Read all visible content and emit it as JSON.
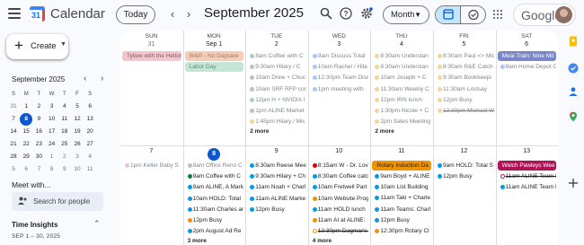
{
  "header": {
    "app_title": "Calendar",
    "logo_num": "31",
    "today_label": "Today",
    "prev_icon": "chevron-left-icon",
    "next_icon": "chevron-right-icon",
    "period": "September 2025",
    "view_label": "Month",
    "account_label": "Google"
  },
  "sidebar": {
    "create_label": "Create",
    "mini_title": "September 2025",
    "weekday_initials": [
      "S",
      "M",
      "T",
      "W",
      "T",
      "F",
      "S"
    ],
    "weeks": [
      [
        "31",
        "1",
        "2",
        "3",
        "4",
        "5",
        "6"
      ],
      [
        "7",
        "8",
        "9",
        "10",
        "11",
        "12",
        "13"
      ],
      [
        "14",
        "15",
        "16",
        "17",
        "18",
        "19",
        "20"
      ],
      [
        "21",
        "22",
        "23",
        "24",
        "25",
        "26",
        "27"
      ],
      [
        "28",
        "29",
        "30",
        "1",
        "2",
        "3",
        "4"
      ],
      [
        "5",
        "6",
        "7",
        "8",
        "9",
        "10",
        "11"
      ]
    ],
    "selected_day": "8",
    "meet_title": "Meet with...",
    "search_placeholder": "Search for people",
    "insights_title": "Time Insights",
    "insights_range": "SEP 1 – 30, 2025"
  },
  "grid": {
    "weekdays": [
      "SUN",
      "MON",
      "TUE",
      "WED",
      "THU",
      "FRI",
      "SAT"
    ],
    "week1_days": [
      "31",
      "Sep 1",
      "2",
      "3",
      "4",
      "5",
      "6"
    ],
    "week2_days": [
      "7",
      "8",
      "9",
      "10",
      "11",
      "12",
      "13"
    ],
    "week1_bars": [
      {
        "col": 0,
        "text": "Tybee with the Heltons!",
        "bg": "#f3c5ce",
        "fg": "#7f6066"
      },
      {
        "col": 1,
        "text": "W&P - No Daycare",
        "bg": "#f3cdb8",
        "fg": "#a0766a"
      },
      {
        "col": 1,
        "text": "Labor Day",
        "bg": "#c5e6d5",
        "fg": "#5d8f74"
      },
      {
        "col": 6,
        "text": "Meal Train: Nine Mil",
        "bg": "#7b86c6",
        "fg": "#ffffff"
      }
    ],
    "week1_events": [
      {
        "col": 2,
        "text": "8am Coffee with C",
        "dot": "#b6c7c0",
        "past": true
      },
      {
        "col": 2,
        "text": "9:30am Hilary / C",
        "dot": "#b6c7c0",
        "past": true
      },
      {
        "col": 2,
        "text": "10am Drew + Chuc",
        "dot": "#b6c7c0",
        "past": true
      },
      {
        "col": 2,
        "text": "10am SRF RFP con",
        "dot": "#b6c7c0",
        "past": true
      },
      {
        "col": 2,
        "text": "12pm H + NVIDIA I",
        "dot": "#b6c7c0",
        "past": true
      },
      {
        "col": 2,
        "text": "1pm ALINE Market",
        "dot": "#b6c7c0",
        "past": true
      },
      {
        "col": 2,
        "text": "1:45pm Hilary / Mic",
        "dot": "#f4d49b",
        "past": true
      },
      {
        "col": 3,
        "text": "9am Discuss Total",
        "dot": "#a8c7fa",
        "past": true
      },
      {
        "col": 3,
        "text": "10am Rachel / Hila",
        "dot": "#a8c7fa",
        "past": true
      },
      {
        "col": 3,
        "text": "12:30pm Team Disc",
        "dot": "#a8c7fa",
        "past": true
      },
      {
        "col": 3,
        "text": "1pm meeting with",
        "dot": "#a8c7fa",
        "past": true
      },
      {
        "col": 4,
        "text": "8:30am Understan",
        "dot": "#f4d49b",
        "past": true
      },
      {
        "col": 4,
        "text": "8:30am Understan",
        "dot": "#f4d49b",
        "past": true
      },
      {
        "col": 4,
        "text": "10am Joseph + C",
        "dot": "#f4d49b",
        "past": true
      },
      {
        "col": 4,
        "text": "11:30am Weekly C",
        "dot": "#f4d49b",
        "past": true
      },
      {
        "col": 4,
        "text": "12pm IRN lunch",
        "dot": "#f4d49b",
        "past": true
      },
      {
        "col": 4,
        "text": "1:30pm Nicole + C",
        "dot": "#f4d49b",
        "past": true
      },
      {
        "col": 4,
        "text": "2pm Sales Meeting",
        "dot": "#f4d49b",
        "past": true
      },
      {
        "col": 5,
        "text": "8:30am Paul <> Mic",
        "dot": "#f4d49b",
        "past": true
      },
      {
        "col": 5,
        "text": "8:30am R&E Catch",
        "dot": "#f4d49b",
        "past": true
      },
      {
        "col": 5,
        "text": "9:30am Bookkeepi",
        "dot": "#f4d49b",
        "past": true
      },
      {
        "col": 5,
        "text": "11:30am Lindsay",
        "dot": "#f4d49b",
        "past": true
      },
      {
        "col": 5,
        "text": "12pm Busy",
        "dot": "#f4d49b",
        "past": true
      },
      {
        "col": 5,
        "text": "12:30pm Michael W",
        "dot": "#f4d49b",
        "past": true,
        "strike": true
      },
      {
        "col": 6,
        "text": "9am Home Depot C",
        "dot": "#a8c7fa",
        "past": true
      }
    ],
    "week1_more": [
      {
        "col": 2,
        "text": "2 more"
      },
      {
        "col": 4,
        "text": "2 more"
      }
    ],
    "week2_bars": [
      {
        "col": 4,
        "text": "Rotary Induction Da",
        "bg": "#f09300",
        "fg": "#1f1f1f"
      },
      {
        "col": 6,
        "text": "Welch Pawleys Wee",
        "bg": "#ad1457",
        "fg": "#ffffff"
      }
    ],
    "week2_events": [
      {
        "col": 0,
        "text": "1pm Keller Baby S",
        "dot": "#f3c5ce",
        "past": true
      },
      {
        "col": 1,
        "text": "8am Office Reno C",
        "dot": "#b6c7c0",
        "past": true
      },
      {
        "col": 1,
        "text": "9am Coffee with C",
        "dot": "#0b8043"
      },
      {
        "col": 1,
        "text": "9am ALINE, A Mark",
        "dot": "#039be5"
      },
      {
        "col": 1,
        "text": "10am HOLD: Total",
        "dot": "#039be5"
      },
      {
        "col": 1,
        "text": "11:30am Charles an",
        "dot": "#039be5"
      },
      {
        "col": 1,
        "text": "12pm Busy",
        "dot": "#f09300"
      },
      {
        "col": 1,
        "text": "2pm August Ad Re",
        "dot": "#039be5"
      },
      {
        "col": 2,
        "text": "8:30am Reese Mee",
        "dot": "#039be5"
      },
      {
        "col": 2,
        "text": "9:30am Hilary + Ch",
        "dot": "#039be5"
      },
      {
        "col": 2,
        "text": "11am Noah + Charl",
        "dot": "#039be5"
      },
      {
        "col": 2,
        "text": "11am ALINE Marke",
        "dot": "#039be5"
      },
      {
        "col": 2,
        "text": "12pm Busy",
        "dot": "#039be5"
      },
      {
        "col": 3,
        "text": "8:15am W - Dr. Lov",
        "dot": "#d50000"
      },
      {
        "col": 3,
        "text": "8:30am Coffee catc",
        "dot": "#039be5"
      },
      {
        "col": 3,
        "text": "10am Fretwell Part",
        "dot": "#039be5"
      },
      {
        "col": 3,
        "text": "10am Website Prog",
        "dot": "#f09300"
      },
      {
        "col": 3,
        "text": "11am HOLD lunch",
        "dot": "#039be5"
      },
      {
        "col": 3,
        "text": "11am AI at ALINE:",
        "dot": "#f09300"
      },
      {
        "col": 3,
        "text": "12:30pm Dagmar's Bat",
        "dot": "#f09300",
        "ring": true,
        "strike": true
      },
      {
        "col": 4,
        "text": "9am Boyd + ALINE",
        "dot": "#039be5"
      },
      {
        "col": 4,
        "text": "10am List Building",
        "dot": "#039be5"
      },
      {
        "col": 4,
        "text": "11am Taki + Charle",
        "dot": "#039be5"
      },
      {
        "col": 4,
        "text": "11am Teams: Charl",
        "dot": "#039be5"
      },
      {
        "col": 4,
        "text": "12pm Busy",
        "dot": "#039be5"
      },
      {
        "col": 4,
        "text": "12:30pm Rotary Cl",
        "dot": "#f09300"
      },
      {
        "col": 5,
        "text": "9am HOLD: Total S",
        "dot": "#039be5"
      },
      {
        "col": 5,
        "text": "12pm Busy",
        "dot": "#039be5"
      },
      {
        "col": 6,
        "text": "11am ALINE Team F",
        "dot": "#ad1457",
        "ring": true,
        "strike": true
      },
      {
        "col": 6,
        "text": "11am ALINE Team F",
        "dot": "#039be5"
      }
    ],
    "week2_more": [
      {
        "col": 1,
        "text": "3 more"
      },
      {
        "col": 3,
        "text": "4 more"
      }
    ]
  },
  "rail": {
    "icons": [
      "keep-icon",
      "tasks-icon",
      "contacts-icon",
      "maps-icon",
      "add-icon"
    ]
  }
}
